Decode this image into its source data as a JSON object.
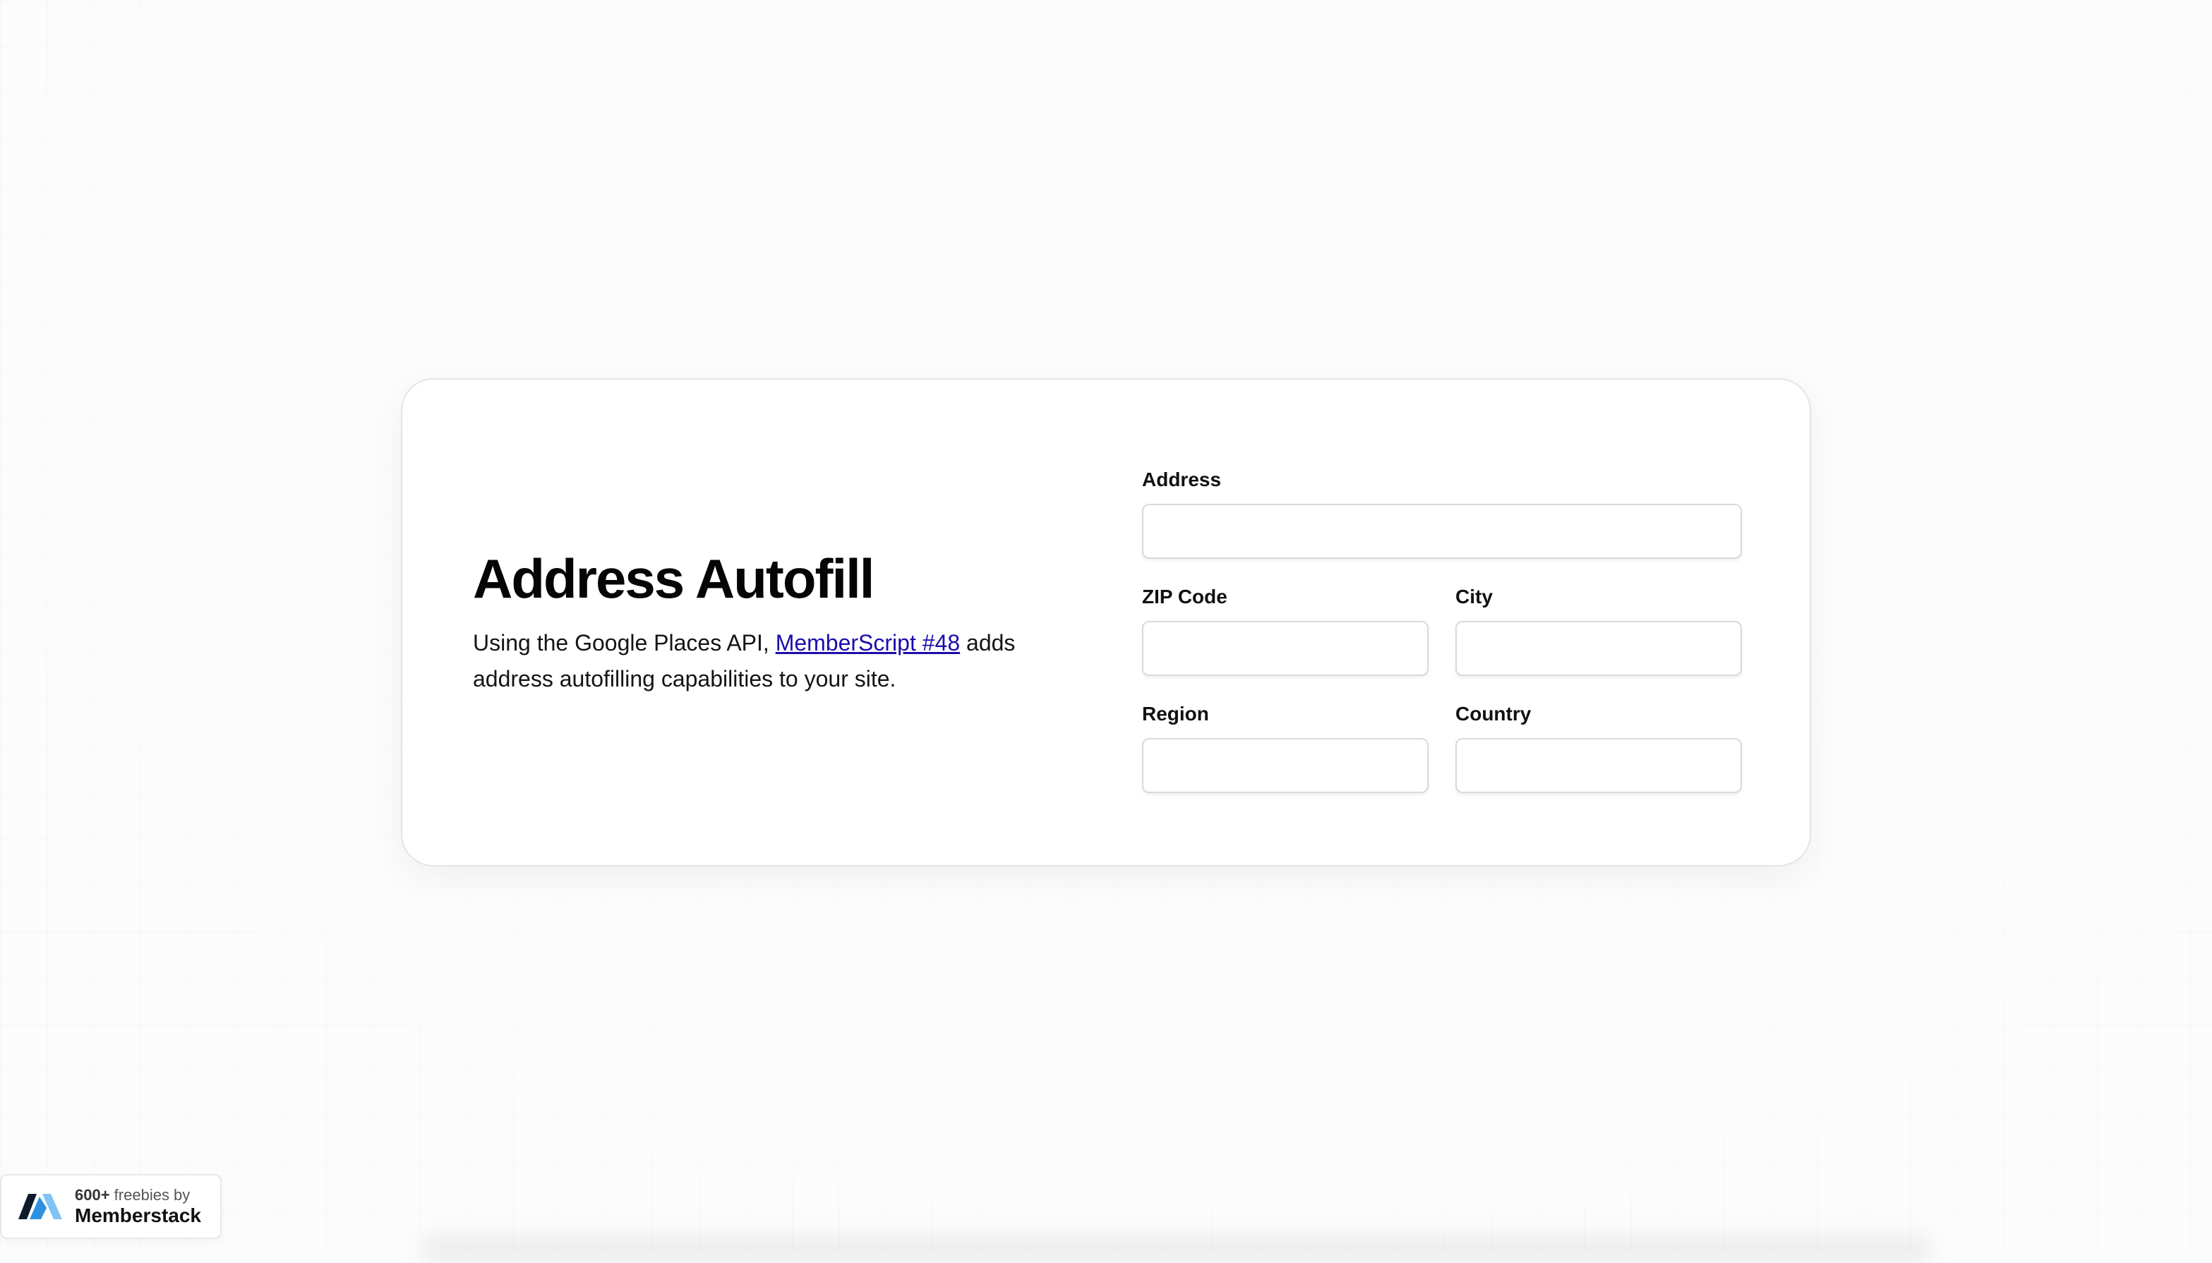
{
  "card": {
    "title": "Address Autofill",
    "description_prefix": "Using the Google Places API, ",
    "description_link": "MemberScript #48",
    "description_suffix": " adds address autofilling capabilities to your site."
  },
  "form": {
    "address_label": "Address",
    "address_value": "",
    "zip_label": "ZIP Code",
    "zip_value": "",
    "city_label": "City",
    "city_value": "",
    "region_label": "Region",
    "region_value": "",
    "country_label": "Country",
    "country_value": ""
  },
  "badge": {
    "count": "600+",
    "tagline": " freebies by",
    "brand": "Memberstack",
    "logo_icon": "memberstack-logo-icon",
    "logo_colors": [
      "#0f1b2d",
      "#2f8fe0",
      "#7fc4f4"
    ]
  }
}
